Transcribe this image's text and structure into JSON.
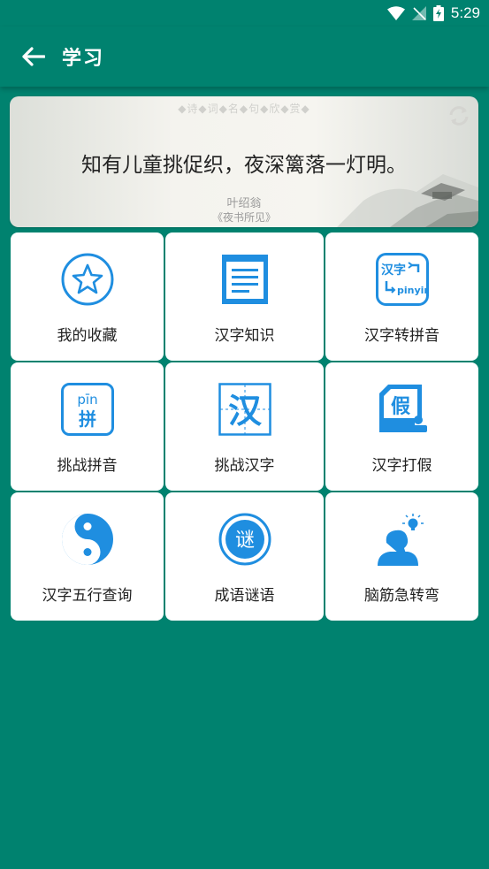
{
  "status": {
    "time": "5:29"
  },
  "app_bar": {
    "title": "学习"
  },
  "poem": {
    "categories": "◆诗◆词◆名◆句◆欣◆赏◆",
    "line": "知有儿童挑促织，夜深篱落一灯明。",
    "author": "叶绍翁",
    "title": "《夜书所见》"
  },
  "tiles": [
    {
      "label": "我的收藏",
      "icon": "star-icon"
    },
    {
      "label": "汉字知识",
      "icon": "document-icon"
    },
    {
      "label": "汉字转拼音",
      "icon": "hanzi-to-pinyin-icon",
      "icon_text_top": "汉字",
      "icon_text_bottom": "pinyin"
    },
    {
      "label": "挑战拼音",
      "icon": "pinyin-challenge-icon",
      "icon_text_top": "pīn",
      "icon_text_bottom": "拼"
    },
    {
      "label": "挑战汉字",
      "icon": "hanzi-challenge-icon",
      "icon_text": "汉"
    },
    {
      "label": "汉字打假",
      "icon": "fake-check-icon",
      "icon_text": "假"
    },
    {
      "label": "汉字五行查询",
      "icon": "yin-yang-icon"
    },
    {
      "label": "成语谜语",
      "icon": "riddle-seal-icon",
      "icon_text": "谜"
    },
    {
      "label": "脑筋急转弯",
      "icon": "brain-teaser-icon"
    }
  ],
  "colors": {
    "primary": "#00826f",
    "icon_blue": "#1f8ee0"
  }
}
